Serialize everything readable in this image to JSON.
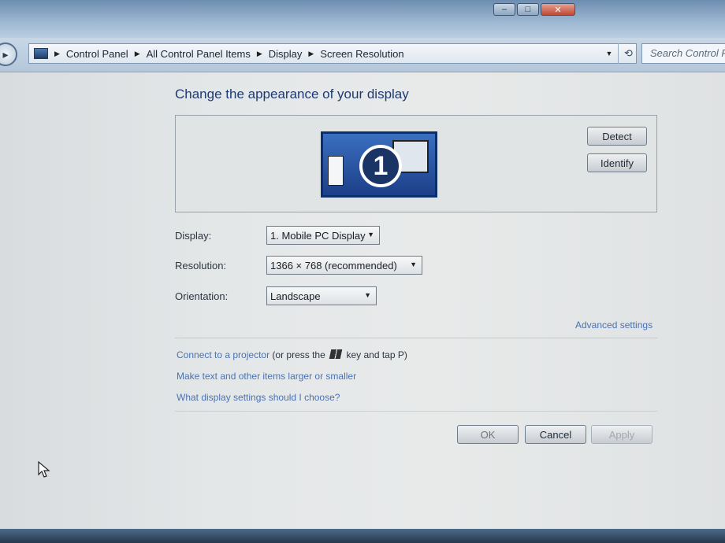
{
  "window": {
    "caption": {
      "minimize": "–",
      "maximize": "□",
      "close": "✕"
    }
  },
  "address": {
    "icon": "control-panel-icon",
    "breadcrumbs": [
      "Control Panel",
      "All Control Panel Items",
      "Display",
      "Screen Resolution"
    ],
    "search_placeholder": "Search Control Pa"
  },
  "main": {
    "title": "Change the appearance of your display",
    "monitor_number": "1",
    "detect_label": "Detect",
    "identify_label": "Identify",
    "display": {
      "label": "Display:",
      "value": "1. Mobile PC Display"
    },
    "resolution": {
      "label": "Resolution:",
      "value": "1366 × 768 (recommended)"
    },
    "orientation": {
      "label": "Orientation:",
      "value": "Landscape"
    },
    "advanced_link": "Advanced settings",
    "projector_link": "Connect to a projector",
    "projector_hint_before": "(or press the",
    "projector_hint_after": "key and tap P)",
    "text_size_link": "Make text and other items larger or smaller",
    "help_link": "What display settings should I choose?",
    "ok_label": "OK",
    "cancel_label": "Cancel",
    "apply_label": "Apply"
  },
  "colors": {
    "link": "#4a72b4",
    "heading": "#1e3a73",
    "monitor": "#1c3f88"
  }
}
